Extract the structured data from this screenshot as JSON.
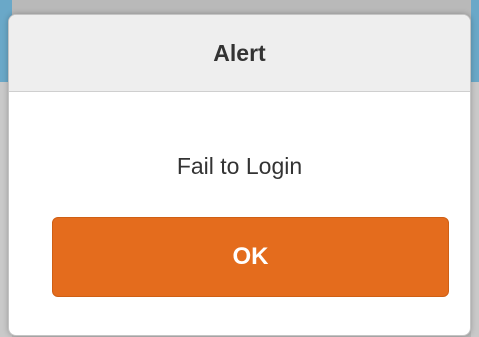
{
  "alert": {
    "title": "Alert",
    "message": "Fail to Login",
    "ok_label": "OK"
  },
  "colors": {
    "accent": "#e46c1d",
    "header_bg": "#eeeeee",
    "backdrop_blue": "#6aa8c8"
  }
}
